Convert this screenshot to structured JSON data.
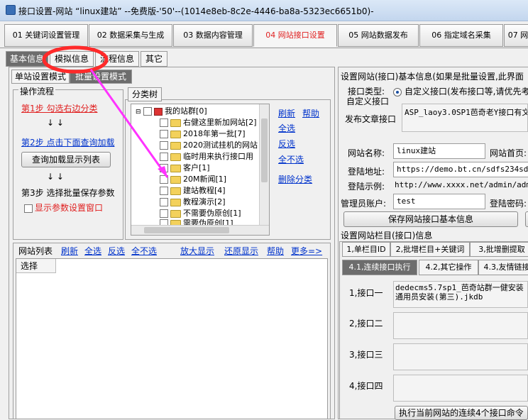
{
  "window": {
    "title": "接口设置-网站 “linux建站” --免费版-'50'--(1014e8eb-8c2e-4446-ba8a-5323ec6651b0)-"
  },
  "main_tabs": [
    "01 关键词设置管理",
    "02 数据采集与生成",
    "03 数据内容管理",
    "04 网站接口设置",
    "05 网站数据发布",
    "06 指定域名采集",
    "07 网"
  ],
  "sub_tabs": [
    "基本信息",
    "模拟信息",
    "流程信息",
    "其它"
  ],
  "mode_tabs": [
    "单站设置模式",
    "批量设置模式"
  ],
  "flow": {
    "title": "操作流程",
    "step1": "第1步  勾选右边分类",
    "step2": "第2步  点击下面查询加载",
    "query_btn": "查询加载显示列表",
    "step3": "第3步  选择批量保存参数",
    "show_params": "显示参数设置窗口",
    "arrows": "↓  ↓"
  },
  "tree": {
    "title": "分类树",
    "root": "我的站群[0]",
    "items": [
      "右健这里新加网站[2]",
      "2018年第一批[7]",
      "2020测试挂机的网站",
      "临时用来执行接口用",
      "客户[1]",
      "20M新闻[1]",
      "建站教程[4]",
      "教程演示[2]",
      "不需要伪原创[1]",
      "需要伪原创[1]"
    ],
    "links": [
      "刷新",
      "帮助",
      "全选",
      "反选",
      "全不选",
      "删除分类"
    ]
  },
  "site_list": {
    "title": "网站列表",
    "links": [
      "刷新",
      "全选",
      "反选",
      "全不选",
      "放大显示",
      "还原显示",
      "帮助",
      "更多=>"
    ],
    "col": "选择"
  },
  "right": {
    "title": "设置网站(接口)基本信息(如果是批量设置,此界面",
    "iface_type_label": "接口类型:",
    "iface_type_value": "自定义接口(发布接口等,请优先考",
    "custom_label": "自定义接口",
    "publish_label": "发布文章接口",
    "publish_value": "ASP_laoy3.0SP1芭奇老Y接口有文",
    "site_name_label": "网站名称:",
    "site_name": "linux建站",
    "home_label": "网站首页:",
    "login_url_label": "登陆地址:",
    "login_url": "https://demo.bt.cn/sdfs234sdf/",
    "login_example_label": "登陆示例:",
    "login_example": "http://www.xxxx.net/admin/admin",
    "admin_label": "管理员账户:",
    "admin": "test",
    "pwd_label": "登陆密码:",
    "save_btn": "保存网站接口基本信息"
  },
  "column_section": {
    "title": "设置网站栏目(接口)信息",
    "tabs": [
      "1,单栏目ID",
      "2,批增栏目+关键词",
      "3,批增删提取"
    ],
    "sub_tabs": [
      "4.1,连续接口执行",
      "4.2,其它操作",
      "4.3,友情链接"
    ],
    "iface_labels": [
      "1,接口一",
      "2,接口二",
      "3,接口三",
      "4,接口四"
    ],
    "iface1_value": "dedecms5.7sp1_芭奇站群一健安装通用员安装(第三).jkdb",
    "exec_btn": "执行当前网站的连续4个接口命令"
  }
}
